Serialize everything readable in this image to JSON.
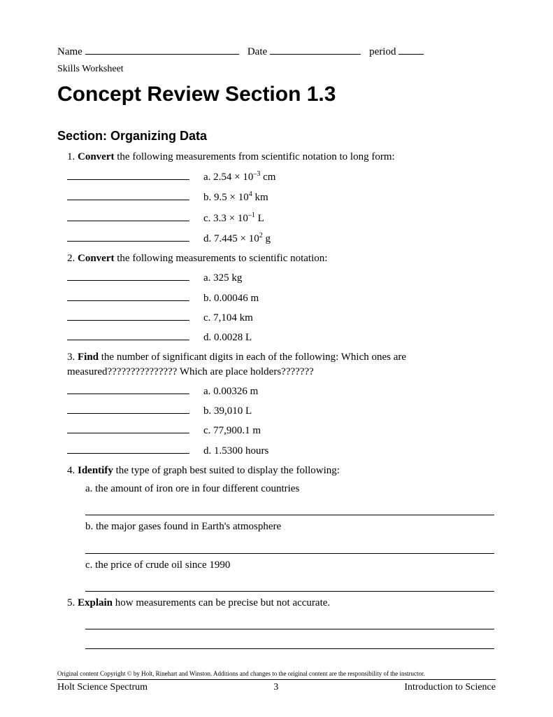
{
  "header": {
    "name_label": "Name",
    "date_label": "Date",
    "period_label": "period",
    "skills": "Skills Worksheet"
  },
  "title": "Concept Review Section 1.3",
  "section_heading": "Section: Organizing Data",
  "q1": {
    "num": "1.",
    "bold": "Convert",
    "rest": " the following measurements from scientific notation to long form:",
    "a_pre": "a. 2.54 × 10",
    "a_sup": "–3",
    "a_post": " cm",
    "b_pre": "b. 9.5 × 10",
    "b_sup": "4",
    "b_post": " km",
    "c_pre": "c. 3.3 × 10",
    "c_sup": "–1",
    "c_post": " L",
    "d_pre": "d. 7.445 × 10",
    "d_sup": "2",
    "d_post": " g"
  },
  "q2": {
    "num": "2.",
    "bold": "Convert",
    "rest": " the following measurements to scientific notation:",
    "a": "a. 325 kg",
    "b": "b. 0.00046 m",
    "c": "c. 7,104 km",
    "d": "d. 0.0028 L"
  },
  "q3": {
    "num": "3.",
    "bold": "Find",
    "rest": " the number of significant digits in each of the following: Which ones are measured???????????????     Which are place holders???????",
    "a": "a. 0.00326 m",
    "b": "b. 39,010 L",
    "c": "c. 77,900.1 m",
    "d": "d. 1.5300 hours"
  },
  "q4": {
    "num": "4.",
    "bold": "Identify",
    "rest": " the type of graph best suited to display the following:",
    "a": "a. the amount of iron ore in four different countries",
    "b": "b. the major gases found in Earth's atmosphere",
    "c": "c. the price of crude oil since 1990"
  },
  "q5": {
    "num": "5.",
    "bold": "Explain",
    "rest": " how measurements can be precise but not accurate."
  },
  "footer": {
    "copyright": "Original content Copyright © by Holt, Rinehart and Winston. Additions and changes to the original content are the responsibility of the instructor.",
    "left": "Holt Science Spectrum",
    "center": "3",
    "right": "Introduction to Science"
  }
}
